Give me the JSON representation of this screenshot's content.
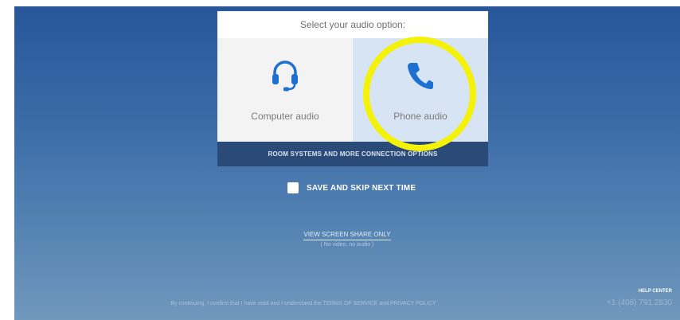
{
  "card": {
    "title": "Select your audio option:",
    "options": [
      {
        "label": "Computer audio",
        "icon": "headset-icon"
      },
      {
        "label": "Phone audio",
        "icon": "phone-icon",
        "selected": true
      }
    ],
    "room_systems_label": "ROOM SYSTEMS AND MORE CONNECTION OPTIONS"
  },
  "save_skip": {
    "label": "SAVE AND SKIP NEXT TIME",
    "checked": false
  },
  "view_share": {
    "link": "VIEW SCREEN SHARE ONLY",
    "sub": "( No video, no audio )"
  },
  "footer": {
    "text": "By continuing, I confirm that I have read and I understand the",
    "terms": "TERMS OF SERVICE",
    "and": "and",
    "privacy": "PRIVACY POLICY"
  },
  "help": {
    "title": "HELP CENTER",
    "phone": "+1 (408) 791 2830"
  },
  "colors": {
    "accent_blue": "#1d6fd0",
    "highlight_yellow": "#f5f20a",
    "room_bar": "#2a4a78"
  }
}
